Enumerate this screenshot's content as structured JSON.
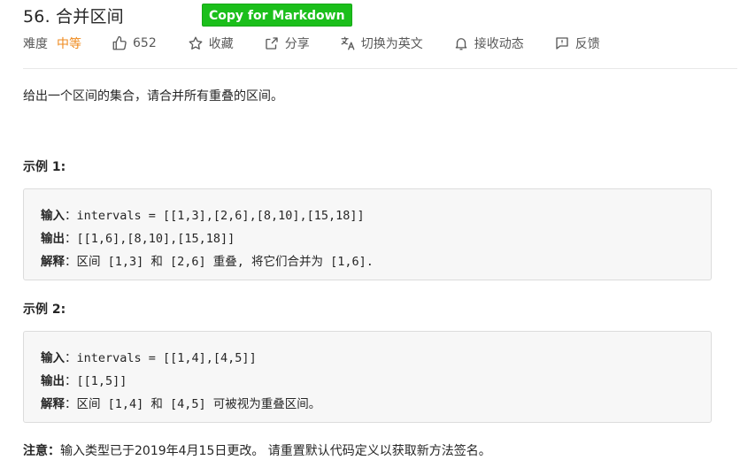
{
  "problem": {
    "title": "56. 合并区间",
    "copy_button": "Copy for Markdown"
  },
  "meta": {
    "difficulty_label": "难度",
    "difficulty_value": "中等",
    "likes": "652",
    "favorite": "收藏",
    "share": "分享",
    "translate": "切换为英文",
    "subscribe": "接收动态",
    "feedback": "反馈"
  },
  "description": "给出一个区间的集合，请合并所有重叠的区间。",
  "examples": [
    {
      "title": "示例 1:",
      "input_label": "输入",
      "input": "：intervals = [[1,3],[2,6],[8,10],[15,18]]",
      "output_label": "输出",
      "output": "：[[1,6],[8,10],[15,18]]",
      "explain_label": "解释",
      "explain": "：区间 [1,3] 和 [2,6] 重叠, 将它们合并为 [1,6]."
    },
    {
      "title": "示例 2:",
      "input_label": "输入",
      "input": "：intervals = [[1,4],[4,5]]",
      "output_label": "输出",
      "output": "：[[1,5]]",
      "explain_label": "解释",
      "explain": "：区间 [1,4] 和 [4,5] 可被视为重叠区间。"
    }
  ],
  "note": {
    "label": "注意：",
    "text": "输入类型已于2019年4月15日更改。 请重置默认代码定义以获取新方法签名。"
  },
  "colors": {
    "difficulty_medium": "#ef8a1d",
    "copy_button_bg": "#1bbf1b"
  },
  "icons": [
    "thumbs-up-icon",
    "star-icon",
    "share-icon",
    "translate-icon",
    "bell-icon",
    "feedback-icon"
  ]
}
